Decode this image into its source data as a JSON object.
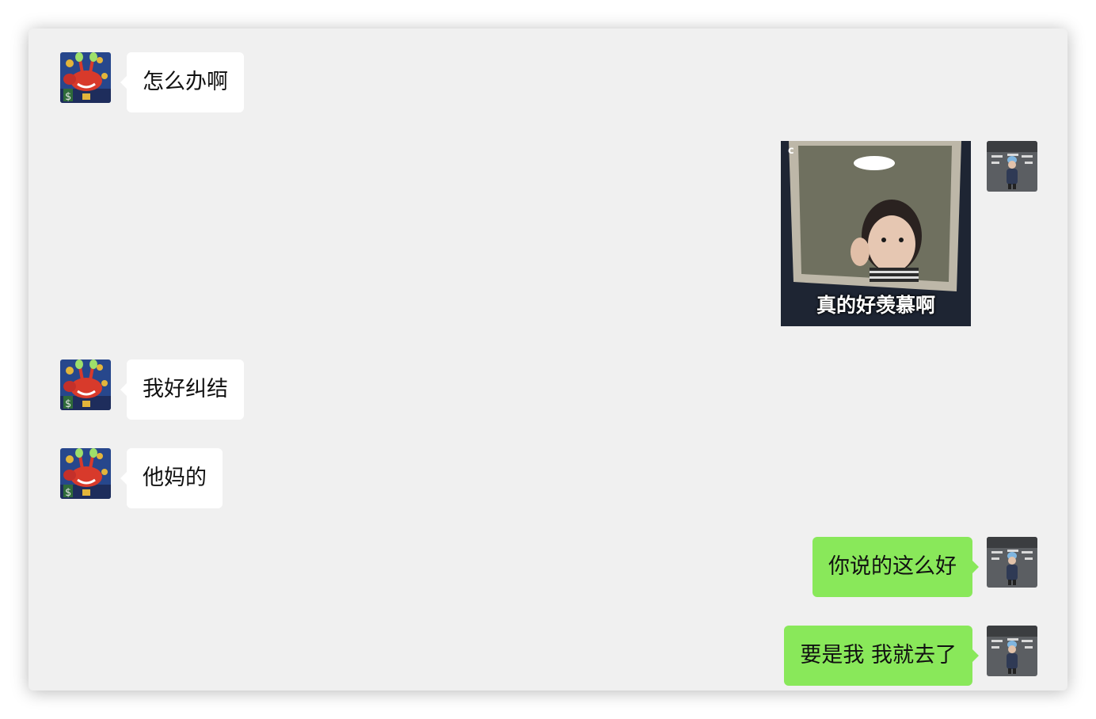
{
  "messages": [
    {
      "side": "incoming",
      "type": "text",
      "text": "怎么办啊"
    },
    {
      "side": "outgoing",
      "type": "sticker",
      "caption": "真的好羡慕啊",
      "watermark": "c"
    },
    {
      "side": "incoming",
      "type": "text",
      "text": "我好纠结"
    },
    {
      "side": "incoming",
      "type": "text",
      "text": "他妈的"
    },
    {
      "side": "outgoing",
      "type": "text",
      "text": "你说的这么好"
    },
    {
      "side": "outgoing",
      "type": "text",
      "text": "要是我 我就去了"
    }
  ],
  "colors": {
    "outgoing_bubble": "#89e85a",
    "incoming_bubble": "#ffffff",
    "chat_background": "#f0f0f0"
  },
  "icons": {
    "incoming_avatar": "crab-cartoon-avatar",
    "outgoing_avatar": "child-street-photo-avatar"
  }
}
